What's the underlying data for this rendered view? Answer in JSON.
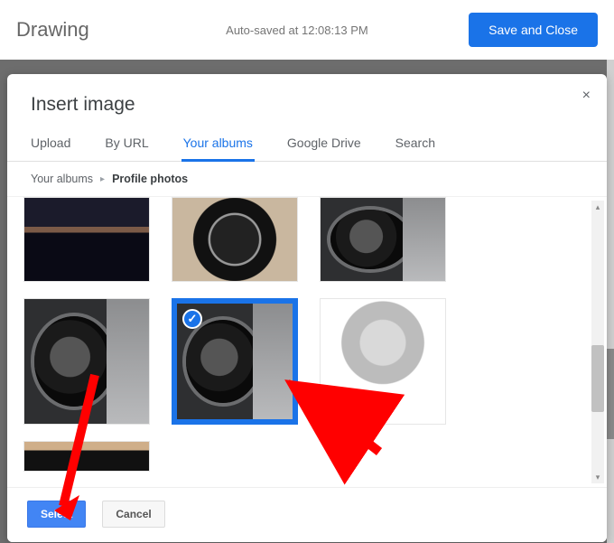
{
  "header": {
    "title": "Drawing",
    "autosave": "Auto-saved at 12:08:13 PM",
    "save_close": "Save and Close"
  },
  "dialog": {
    "title": "Insert image",
    "tabs": {
      "upload": "Upload",
      "by_url": "By URL",
      "your_albums": "Your albums",
      "google_drive": "Google Drive",
      "search": "Search"
    },
    "active_tab": "your_albums",
    "breadcrumb": {
      "root": "Your albums",
      "album": "Profile photos"
    },
    "footer": {
      "select": "Select",
      "cancel": "Cancel"
    }
  },
  "grid": {
    "items": [
      {
        "kind": "portrait",
        "selected": false
      },
      {
        "kind": "wheel",
        "selected": false
      },
      {
        "kind": "headlight",
        "selected": false
      },
      {
        "kind": "headlight",
        "selected": false
      },
      {
        "kind": "headlight",
        "selected": true
      },
      {
        "kind": "bwportrait",
        "selected": false
      },
      {
        "kind": "hair",
        "selected": false
      }
    ]
  },
  "icons": {
    "close": "×",
    "check": "✓",
    "chevron": "▸",
    "up": "▴",
    "down": "▾"
  }
}
